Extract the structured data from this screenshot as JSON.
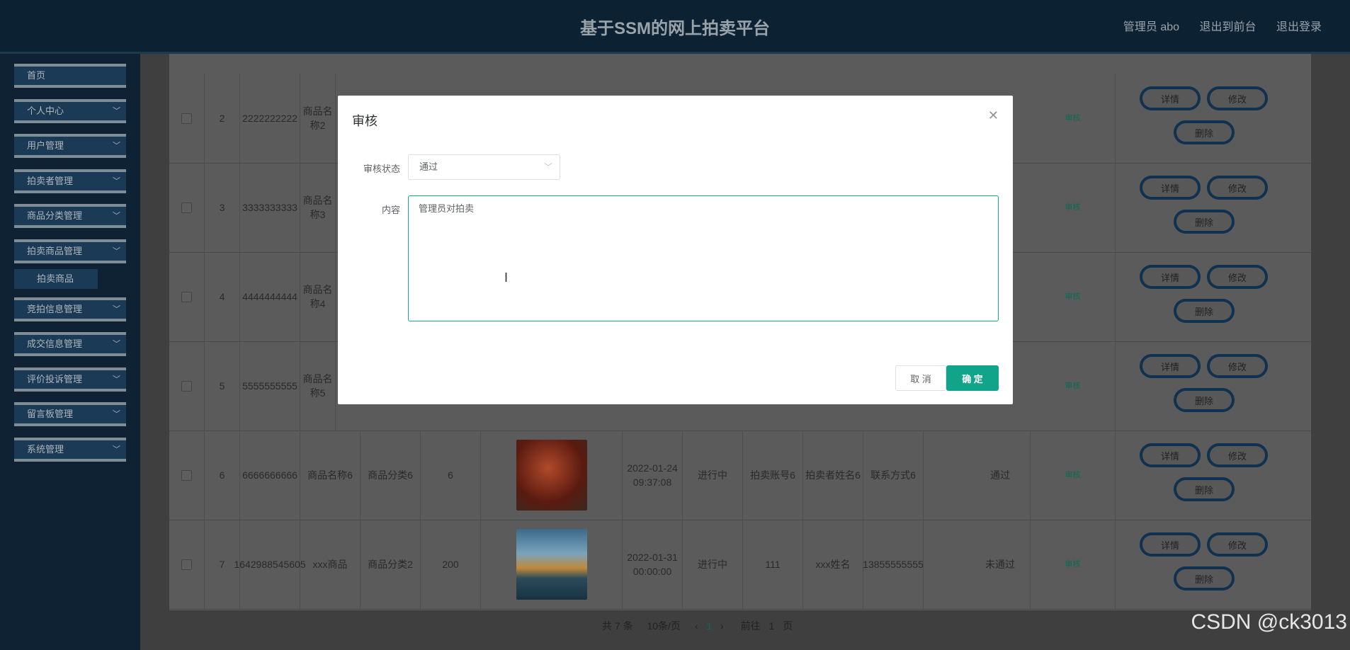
{
  "header": {
    "title": "基于SSM的网上拍卖平台",
    "admin_label": "管理员 abo",
    "goto_front": "退出到前台",
    "logout": "退出登录"
  },
  "sidebar": {
    "items": [
      {
        "label": "首页"
      },
      {
        "label": "个人中心"
      },
      {
        "label": "用户管理"
      },
      {
        "label": "拍卖者管理"
      },
      {
        "label": "商品分类管理"
      },
      {
        "label": "拍卖商品管理"
      },
      {
        "label": "竞拍信息管理"
      },
      {
        "label": "成交信息管理"
      },
      {
        "label": "评价投诉管理"
      },
      {
        "label": "留言板管理"
      },
      {
        "label": "系统管理"
      }
    ],
    "sub_item": "拍卖商品"
  },
  "table": {
    "rows": [
      {
        "idx": "2",
        "no": "2222222222",
        "name": "商品名称2",
        "category": "",
        "price": "",
        "time": "",
        "status": "",
        "account": "",
        "seller": "",
        "contact": "",
        "review": "",
        "audit": "审核"
      },
      {
        "idx": "3",
        "no": "3333333333",
        "name": "商品名称3",
        "category": "",
        "price": "",
        "time": "",
        "status": "",
        "account": "",
        "seller": "",
        "contact": "",
        "review": "",
        "audit": "审核"
      },
      {
        "idx": "4",
        "no": "4444444444",
        "name": "商品名称4",
        "category": "",
        "price": "",
        "time": "",
        "status": "",
        "account": "",
        "seller": "",
        "contact": "",
        "review": "",
        "audit": "审核"
      },
      {
        "idx": "5",
        "no": "5555555555",
        "name": "商品名称5",
        "category": "",
        "price": "",
        "time": "",
        "status": "",
        "account": "",
        "seller": "",
        "contact": "",
        "review": "",
        "audit": "审核"
      },
      {
        "idx": "6",
        "no": "6666666666",
        "name": "商品名称6",
        "category": "商品分类6",
        "price": "6",
        "time": "2022-01-24 09:37:08",
        "status": "进行中",
        "account": "拍卖账号6",
        "seller": "拍卖者姓名6",
        "contact": "联系方式6",
        "review": "通过",
        "audit": "审核"
      },
      {
        "idx": "7",
        "no": "1642988545605",
        "name": "xxx商品",
        "category": "商品分类2",
        "price": "200",
        "time": "2022-01-31 00:00:00",
        "status": "进行中",
        "account": "111",
        "seller": "xxx姓名",
        "contact": "13855555555",
        "review": "未通过",
        "audit": "审核"
      }
    ],
    "buttons": {
      "detail": "详情",
      "edit": "修改",
      "delete": "删除"
    }
  },
  "pager": {
    "total": "共 7 条",
    "page_size": "10条/页",
    "current": "1",
    "goto_label": "前往",
    "goto_value": "1",
    "page_suffix": "页"
  },
  "modal": {
    "title": "审核",
    "status_label": "审核状态",
    "status_value": "通过",
    "content_label": "内容",
    "content_value": "管理员对拍卖",
    "cancel": "取 消",
    "confirm": "确 定"
  },
  "watermark": "CSDN @ck3013",
  "colors": {
    "header_bg": "#0c2232",
    "sidebar_item": "#1b3a55",
    "accent": "#12a48a",
    "overlay_row": "#5b5b5b"
  }
}
